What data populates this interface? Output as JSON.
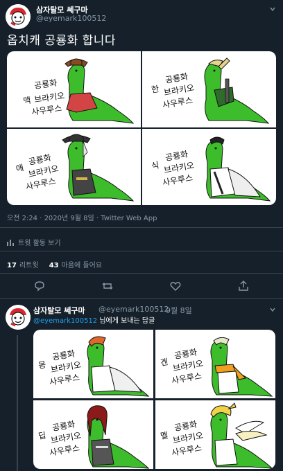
{
  "tweet": {
    "author_name": "삼자탈모 쎄구마",
    "author_handle": "@eyemark100512",
    "text": "옵치캐 공룡화 합니다",
    "meta": "오전 2:24 · 2020년 9월 8일 · Twitter Web App",
    "activity_label": "트윗 활동 보기",
    "retweets_count": "17",
    "retweets_label": "리트윗",
    "likes_count": "43",
    "likes_label": "마음에 들어요",
    "panels": [
      {
        "prefix": "맥",
        "line1": "공룡화",
        "line2": "브라키오",
        "line3": "사우루스"
      },
      {
        "prefix": "한",
        "line1": "공룡화",
        "line2": "브라키오",
        "line3": "사우루스"
      },
      {
        "prefix": "애",
        "line1": "공룡화",
        "line2": "브라키오",
        "line3": "사우루스"
      },
      {
        "prefix": "식",
        "line1": "공룡화",
        "line2": "브라키오",
        "line3": "사우루스"
      }
    ]
  },
  "reply": {
    "author_name": "삼자탈모 쎄구마",
    "author_handle": "@eyemark100512",
    "date": "· 9월 8일",
    "mention": "@eyemark100512",
    "reply_text": " 님에게 보내는 답글",
    "panels": [
      {
        "prefix": "몽",
        "line1": "공룡화",
        "line2": "브라키오",
        "line3": "사우루스"
      },
      {
        "prefix": "겐",
        "line1": "공룡화",
        "line2": "브라키오",
        "line3": "사우루스"
      },
      {
        "prefix": "딥",
        "line1": "공룡화",
        "line2": "브라키오",
        "line3": "사우루스"
      },
      {
        "prefix": "멜",
        "line1": "공룡화",
        "line2": "브라키오",
        "line3": "사우루스"
      }
    ]
  },
  "icons": {
    "more": "chevron-down-icon",
    "reply": "reply-icon",
    "retweet": "retweet-icon",
    "like": "heart-icon",
    "share": "share-icon",
    "activity": "bar-chart-icon"
  },
  "colors": {
    "background": "#15202b",
    "secondary_text": "#8899a6",
    "link": "#1da1f2",
    "divider": "#38444d",
    "dino_green": "#3dbd2b"
  }
}
